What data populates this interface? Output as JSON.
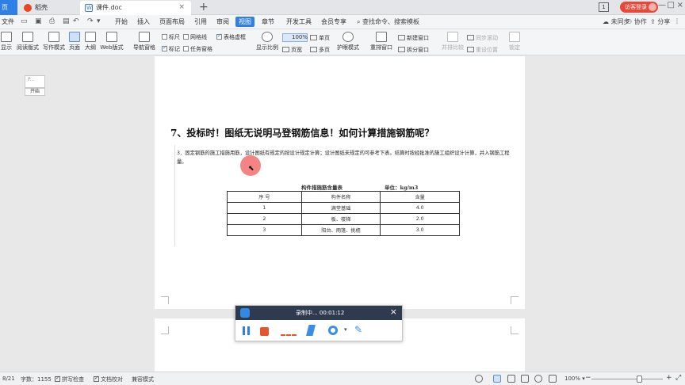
{
  "tabs": {
    "home": "页",
    "items": [
      {
        "label": "稻壳"
      },
      {
        "label": "课件.doc"
      }
    ],
    "add": "+",
    "close": "×"
  },
  "window": {
    "badge": "1",
    "visitor": "访客登录",
    "min": "—",
    "max": "□",
    "close": "×"
  },
  "menubar": {
    "file": "文件",
    "items": [
      "开始",
      "插入",
      "页面布局",
      "引用",
      "审阅",
      "视图",
      "章节",
      "开发工具",
      "会员专享"
    ],
    "active_index": 5,
    "search": "查找命令、搜索模板",
    "unsynced": "未同步",
    "collab": "协作",
    "share": "分享"
  },
  "ribbon": {
    "buttons": {
      "show": "显示",
      "reading": "阅读版式",
      "writing": "写作模式",
      "page": "页面",
      "outline": "大纲",
      "web": "Web版式",
      "nav": "导航窗格",
      "zoom_scale": "显示比例",
      "eye": "护眼模式",
      "rearrange": "重排窗口",
      "side_by_side": "并排比较",
      "lock": "锁定"
    },
    "checks": {
      "ruler": "标尺",
      "grid": "网格线",
      "table_virtual": "表格虚框",
      "marks": "标记",
      "task_pane": "任务窗格"
    },
    "zoom": "100%",
    "single_page": "单页",
    "page_width": "页宽",
    "multi_page": "多页",
    "new_window": "新建窗口",
    "split_window": "拆分窗口",
    "sync_scroll": "同步滚动",
    "reset_pos": "重设位置"
  },
  "thumb": {
    "preview": "P...",
    "label": "开始"
  },
  "doc": {
    "heading": "7、投标时！图纸无说明马登钢筋信息！如何计算措施钢筋呢？",
    "paragraph": "3．固定钢筋的施工措施用筋，设计图纸有规定的按设计规定计算；设计图纸未规定的可参考下表。结算时按经批准的施工组织设计计算，并入钢筋工程量。",
    "table_title": "构件措施筋含量表",
    "table_unit": "单位：kg/m3",
    "table_headers": [
      "序 号",
      "构件名称",
      "含量"
    ],
    "table_rows": [
      [
        "1",
        "满堂基础",
        "4.0"
      ],
      [
        "2",
        "板、楼梯",
        "2.0"
      ],
      [
        "3",
        "阳台、雨篷、挑檐",
        "3.0"
      ]
    ]
  },
  "recorder": {
    "status": "录制中... 00:01:12",
    "close": "×",
    "dropdown": "▾"
  },
  "statusbar": {
    "page": "8/21",
    "words": "字数：1155",
    "spell": "拼写检查",
    "proof": "文档校对",
    "compat": "兼容模式",
    "zoom": "100%",
    "minus": "−",
    "plus": "+"
  }
}
